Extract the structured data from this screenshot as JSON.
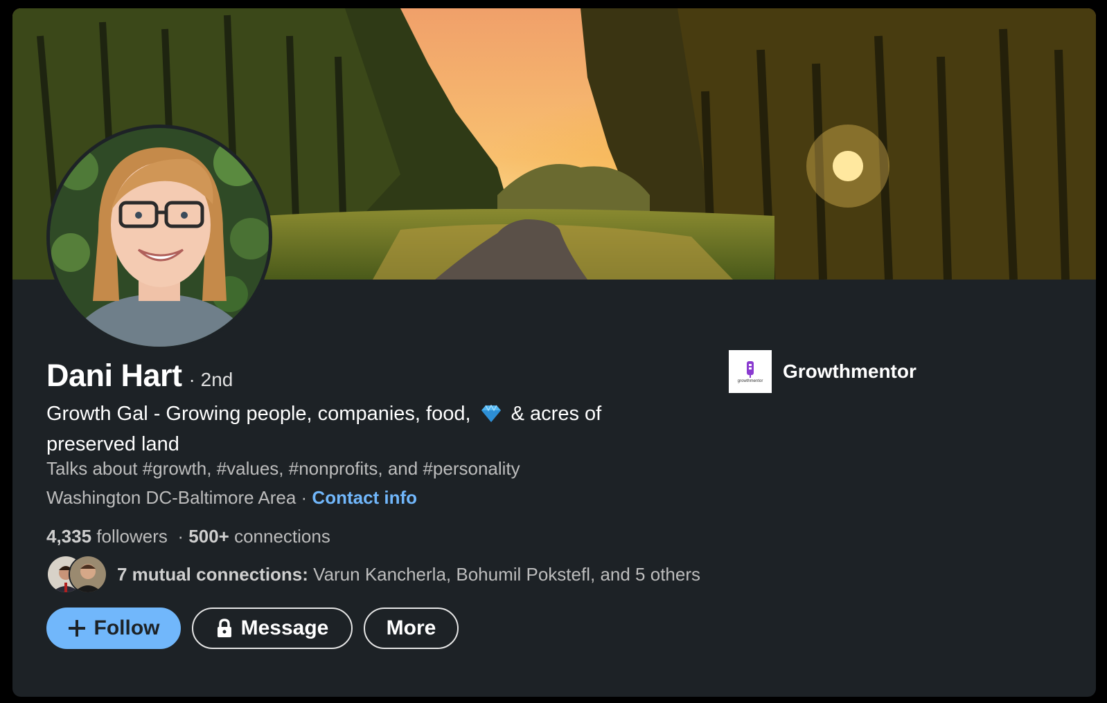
{
  "profile": {
    "name": "Dani Hart",
    "degree": "· 2nd",
    "headline_before": "Growth Gal - Growing people, companies, food,",
    "headline_after": "& acres of preserved land",
    "talks_about": "Talks about #growth, #values, #nonprofits, and #personality",
    "location": "Washington DC-Baltimore Area ·",
    "contact_info": "Contact info"
  },
  "stats": {
    "followers_count": "4,335",
    "followers_label": "followers",
    "separator": "·",
    "connections_count": "500+",
    "connections_label": "connections"
  },
  "mutual": {
    "label": "7 mutual connections:",
    "names": "Varun Kancherla, Bohumil Pokstefl, and 5 others"
  },
  "actions": {
    "follow": "Follow",
    "message": "Message",
    "more": "More"
  },
  "company": {
    "name": "Growthmentor",
    "logo_text": "growthmentor"
  },
  "colors": {
    "card_bg": "#1d2226",
    "accent": "#71b7fb",
    "text_primary": "#ffffff",
    "text_secondary": "#bdbdbd"
  },
  "icons": [
    "plus-icon",
    "lock-icon",
    "gem-icon",
    "growthmentor-logo"
  ]
}
